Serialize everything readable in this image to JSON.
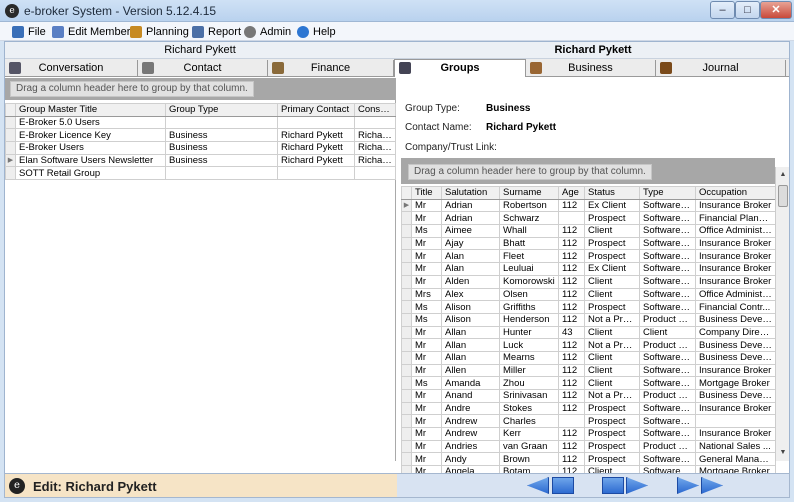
{
  "app": {
    "title": "e-broker System - Version 5.12.4.15"
  },
  "menu": [
    {
      "label": "File",
      "icon": "file-icon",
      "color": "#3a6fb8"
    },
    {
      "label": "Edit Member",
      "icon": "edit-member-icon",
      "color": "#5a7fc4"
    },
    {
      "label": "Planning",
      "icon": "planning-icon",
      "color": "#c78a22"
    },
    {
      "label": "Report",
      "icon": "report-icon",
      "color": "#4b6fa6"
    },
    {
      "label": "Admin",
      "icon": "admin-icon",
      "color": "#666"
    },
    {
      "label": "Help",
      "icon": "help-icon",
      "color": "#2d76d2"
    }
  ],
  "names": {
    "left": "Richard Pykett",
    "right": "Richard Pykett"
  },
  "tabs": [
    {
      "label": "Conversation",
      "icon": "conversation-icon",
      "active": false
    },
    {
      "label": "Contact",
      "icon": "contact-icon",
      "active": false
    },
    {
      "label": "Finance",
      "icon": "finance-icon",
      "active": false
    },
    {
      "label": "Groups",
      "icon": "groups-icon",
      "active": true
    },
    {
      "label": "Business",
      "icon": "business-icon",
      "active": false
    },
    {
      "label": "Journal",
      "icon": "journal-icon",
      "active": false
    }
  ],
  "left_grid": {
    "group_hint": "Drag a column header here to group by that column.",
    "columns": [
      "Group Master Title",
      "Group Type",
      "Primary Contact",
      "Consultar"
    ],
    "rows": [
      [
        "E-Broker 5.0 Users",
        "",
        "",
        ""
      ],
      [
        "E-Broker Licence Key",
        "Business",
        "Richard Pykett",
        "Richard F"
      ],
      [
        "E-Broker Users",
        "Business",
        "Richard Pykett",
        "Richard F"
      ],
      [
        "Elan Software Users Newsletter",
        "Business",
        "Richard Pykett",
        "Richard F"
      ],
      [
        "SOTT Retail Group",
        "",
        "",
        ""
      ]
    ]
  },
  "group_info": {
    "type_label": "Group Type:",
    "type_value": "Business",
    "contact_label": "Contact Name:",
    "contact_value": "Richard Pykett",
    "company_label": "Company/Trust Link:"
  },
  "right_grid": {
    "group_hint": "Drag a column header here to group by that column.",
    "columns": [
      "Title",
      "Salutation",
      "Surname",
      "Age",
      "Status",
      "Type",
      "Occupation"
    ],
    "rows": [
      [
        "Mr",
        "Adrian",
        "Robertson",
        "112",
        "Ex Client",
        "Software Cli...",
        "Insurance Broker"
      ],
      [
        "Mr",
        "Adrian",
        "Schwarz",
        "",
        "Prospect",
        "Software Cli...",
        "Financial Planner"
      ],
      [
        "Ms",
        "Aimee",
        "Whall",
        "112",
        "Client",
        "Software Cli...",
        "Office Administr..."
      ],
      [
        "Mr",
        "Ajay",
        "Bhatt",
        "112",
        "Prospect",
        "Software Cli...",
        "Insurance Broker"
      ],
      [
        "Mr",
        "Alan",
        "Fleet",
        "112",
        "Prospect",
        "Software Cli...",
        "Insurance Broker"
      ],
      [
        "Mr",
        "Alan",
        "Leuluai",
        "112",
        "Ex Client",
        "Software Cli...",
        "Insurance Broker"
      ],
      [
        "Mr",
        "Alden",
        "Komorowski",
        "112",
        "Client",
        "Software Cli...",
        "Insurance Broker"
      ],
      [
        "Mrs",
        "Alex",
        "Olsen",
        "112",
        "Client",
        "Software Cli...",
        "Office Administr..."
      ],
      [
        "Ms",
        "Alison",
        "Griffiths",
        "112",
        "Prospect",
        "Software Cli...",
        "Financial Contr..."
      ],
      [
        "Ms",
        "Alison",
        "Henderson",
        "112",
        "Not a Prosp...",
        "Product Su...",
        "Business Devel..."
      ],
      [
        "Mr",
        "Allan",
        "Hunter",
        "43",
        "Client",
        "Client",
        "Company Director"
      ],
      [
        "Mr",
        "Allan",
        "Luck",
        "112",
        "Not a Prosp...",
        "Product Su...",
        "Business Devel..."
      ],
      [
        "Mr",
        "Allan",
        "Mearns",
        "112",
        "Client",
        "Software Cli...",
        "Business Devel..."
      ],
      [
        "Mr",
        "Allen",
        "Miller",
        "112",
        "Client",
        "Software Cli...",
        "Insurance Broker"
      ],
      [
        "Ms",
        "Amanda",
        "Zhou",
        "112",
        "Client",
        "Software Cli...",
        "Mortgage Broker"
      ],
      [
        "Mr",
        "Anand",
        "Srinivasan",
        "112",
        "Not a Prosp...",
        "Product Su...",
        "Business Devel..."
      ],
      [
        "Mr",
        "Andre",
        "Stokes",
        "112",
        "Prospect",
        "Software Cli...",
        "Insurance Broker"
      ],
      [
        "Mr",
        "Andrew",
        "Charles",
        "",
        "Prospect",
        "Software Cli...",
        ""
      ],
      [
        "Mr",
        "Andrew",
        "Kerr",
        "112",
        "Prospect",
        "Software Cli...",
        "Insurance Broker"
      ],
      [
        "Mr",
        "Andries",
        "van Graan",
        "112",
        "Prospect",
        "Product Su...",
        "National Sales ..."
      ],
      [
        "Mr",
        "Andy",
        "Brown",
        "112",
        "Prospect",
        "Software Cli...",
        "General Manager"
      ],
      [
        "Mr",
        "Angela",
        "Botam",
        "112",
        "Client",
        "Software Cli...",
        "Mortgage Broker"
      ]
    ]
  },
  "status": {
    "text": "Edit: Richard Pykett"
  },
  "nav": [
    "first-record-button",
    "previous-record-button",
    "next-record-button",
    "last-record-button"
  ],
  "colors": {
    "status_bg": "#f6e4c6",
    "nav_blue": "#2e6bd1",
    "titlebar": "#cfe1f5"
  }
}
